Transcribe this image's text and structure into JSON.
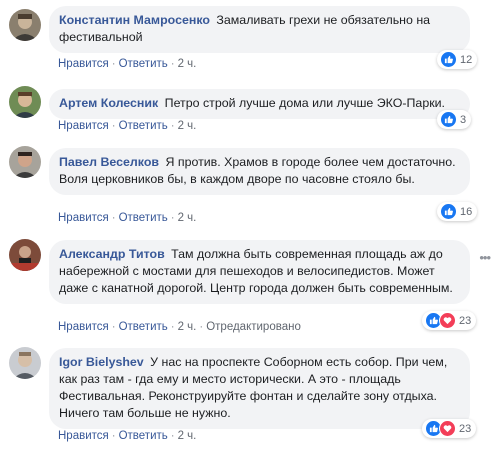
{
  "comments": [
    {
      "author": "Константин Мамросенко",
      "text": "Замаливать грехи не обязательно на фестивальной",
      "actions": {
        "like": "Нравится",
        "reply": "Ответить",
        "time": "2 ч.",
        "edited": ""
      },
      "reactions": {
        "count": "12",
        "types": [
          "like-icon"
        ]
      }
    },
    {
      "author": "Артем Колесник",
      "text": "Петро строй лучше дома или лучше ЭКО-Парки.",
      "actions": {
        "like": "Нравится",
        "reply": "Ответить",
        "time": "2 ч.",
        "edited": ""
      },
      "reactions": {
        "count": "3",
        "types": [
          "like-icon"
        ]
      }
    },
    {
      "author": "Павел Веселков",
      "text": "Я против. Храмов в городе более чем достаточно. Воля церковников бы, в каждом дворе по часовне стояло бы.",
      "actions": {
        "like": "Нравится",
        "reply": "Ответить",
        "time": "2 ч.",
        "edited": ""
      },
      "reactions": {
        "count": "16",
        "types": [
          "like-icon"
        ]
      }
    },
    {
      "author": "Александр Титов",
      "text": "Там должна быть современная площадь аж до набережной с мостами для пешеходов и велосипедистов. Может даже с канатной дорогой. Центр города должен быть современным.",
      "actions": {
        "like": "Нравится",
        "reply": "Ответить",
        "time": "2 ч.",
        "edited": "Отредактировано"
      },
      "reactions": {
        "count": "23",
        "types": [
          "like-icon",
          "love-icon"
        ]
      }
    },
    {
      "author": "Igor Bielyshev",
      "text": "У нас на проспекте Соборном есть собор. При чем, как раз там - гда ему и место исторически. А это - площадь Фестивальная. Реконструируйте фонтан и сделайте зону отдыха. Ничего там больше не нужно.",
      "actions": {
        "like": "Нравится",
        "reply": "Ответить",
        "time": "2 ч.",
        "edited": ""
      },
      "reactions": {
        "count": "23",
        "types": [
          "like-icon",
          "love-icon"
        ]
      }
    }
  ],
  "colors": {
    "author": "#385898",
    "bubble": "#f2f3f5",
    "like": "#1877f2",
    "love": "#f33e58",
    "meta": "#616770"
  }
}
